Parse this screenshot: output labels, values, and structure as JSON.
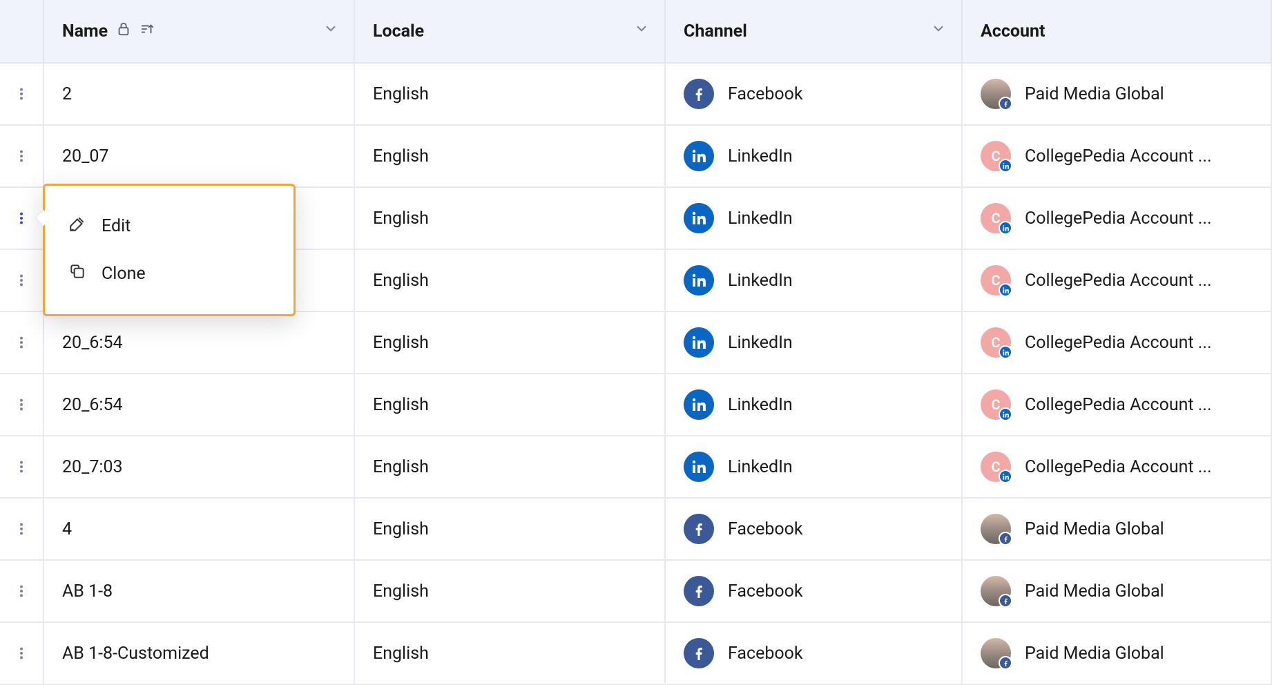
{
  "columns": {
    "name": {
      "label": "Name",
      "locked": true,
      "sorted": true,
      "caret": true
    },
    "locale": {
      "label": "Locale",
      "caret": true
    },
    "channel": {
      "label": "Channel",
      "caret": true
    },
    "account": {
      "label": "Account"
    }
  },
  "channels": {
    "facebook": {
      "label": "Facebook",
      "color": "#3b5998"
    },
    "linkedin": {
      "label": "LinkedIn",
      "color": "#0a66c2"
    }
  },
  "accounts": {
    "global": {
      "label": "Paid Media Global",
      "avatar": "landscape",
      "mini": "facebook"
    },
    "college": {
      "label": "CollegePedia Account ...",
      "avatar": "C",
      "mini": "linkedin"
    }
  },
  "rows": [
    {
      "name": "2",
      "locale": "English",
      "channel": "facebook",
      "account": "global"
    },
    {
      "name": "20_07",
      "locale": "English",
      "channel": "linkedin",
      "account": "college"
    },
    {
      "name": "",
      "locale": "English",
      "channel": "linkedin",
      "account": "college",
      "menu_open": true
    },
    {
      "name": "",
      "locale": "English",
      "channel": "linkedin",
      "account": "college"
    },
    {
      "name": "20_6:54",
      "locale": "English",
      "channel": "linkedin",
      "account": "college"
    },
    {
      "name": "20_6:54",
      "locale": "English",
      "channel": "linkedin",
      "account": "college"
    },
    {
      "name": "20_7:03",
      "locale": "English",
      "channel": "linkedin",
      "account": "college"
    },
    {
      "name": "4",
      "locale": "English",
      "channel": "facebook",
      "account": "global"
    },
    {
      "name": "AB 1-8",
      "locale": "English",
      "channel": "facebook",
      "account": "global"
    },
    {
      "name": "AB 1-8-Customized",
      "locale": "English",
      "channel": "facebook",
      "account": "global"
    }
  ],
  "context_menu": {
    "items": [
      {
        "icon": "edit",
        "label": "Edit"
      },
      {
        "icon": "clone",
        "label": "Clone"
      }
    ]
  }
}
